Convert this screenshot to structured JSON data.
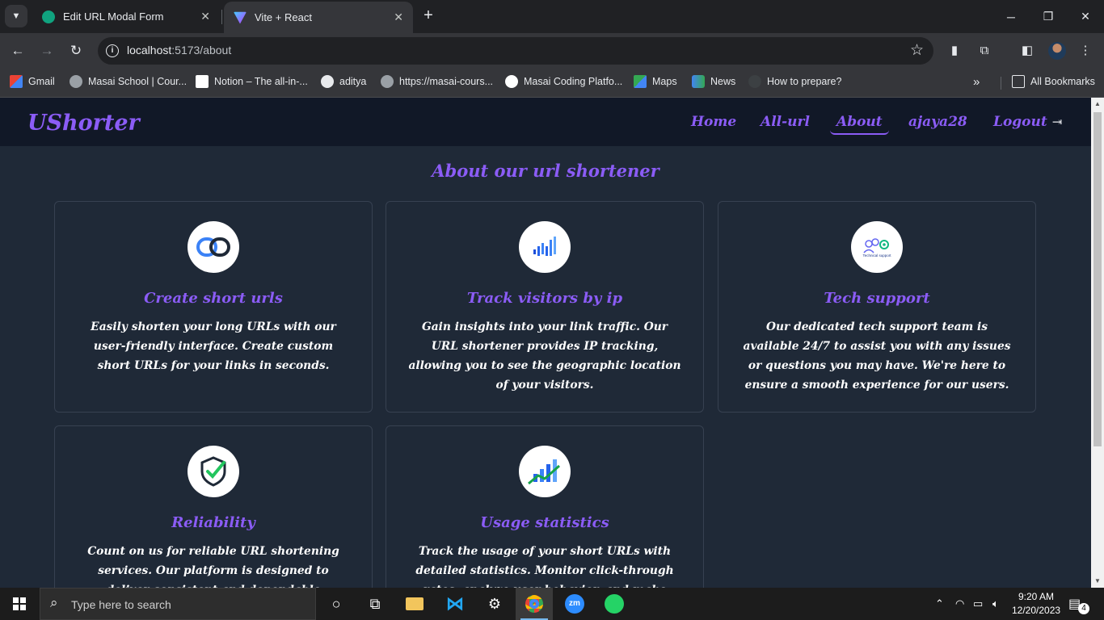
{
  "browser": {
    "tabs": [
      {
        "title": "Edit URL Modal Form",
        "active": false
      },
      {
        "title": "Vite + React",
        "active": true
      }
    ],
    "url_host": "localhost",
    "url_path": ":5173/about",
    "bookmarks": [
      {
        "label": "Gmail",
        "icon": "gmail-icon"
      },
      {
        "label": "Masai School | Cour...",
        "icon": "globe-icon"
      },
      {
        "label": "Notion – The all-in-...",
        "icon": "notion-icon"
      },
      {
        "label": "aditya",
        "icon": "github-icon"
      },
      {
        "label": "https://masai-cours...",
        "icon": "globe-icon"
      },
      {
        "label": "Masai Coding Platfo...",
        "icon": "masai-icon"
      },
      {
        "label": "Maps",
        "icon": "maps-icon"
      },
      {
        "label": "News",
        "icon": "news-icon"
      },
      {
        "label": "How to prepare?",
        "icon": "page-icon"
      }
    ],
    "all_bookmarks": "All Bookmarks"
  },
  "app": {
    "brand": "UShorter",
    "nav": [
      {
        "label": "Home",
        "active": false
      },
      {
        "label": "All-url",
        "active": false
      },
      {
        "label": "About",
        "active": true
      },
      {
        "label": "ajaya28",
        "active": false
      },
      {
        "label": "Logout",
        "active": false
      }
    ],
    "heading": "About our url shortener",
    "cards": [
      {
        "title": "Create short urls",
        "icon": "chain-link-icon",
        "desc": "Easily shorten your long URLs with our user-friendly interface. Create custom short URLs for your links in seconds."
      },
      {
        "title": "Track visitors by ip",
        "icon": "bar-signal-icon",
        "desc": "Gain insights into your link traffic. Our URL shortener provides IP tracking, allowing you to see the geographic location of your visitors."
      },
      {
        "title": "Tech support",
        "icon": "tech-support-icon",
        "icon_text": "Technical support",
        "desc": "Our dedicated tech support team is available 24/7 to assist you with any issues or questions you may have. We're here to ensure a smooth experience for our users."
      },
      {
        "title": "Reliability",
        "icon": "shield-check-icon",
        "desc": "Count on us for reliable URL shortening services. Our platform is designed to deliver consistent and dependable performance."
      },
      {
        "title": "Usage statistics",
        "icon": "growth-chart-icon",
        "desc": "Track the usage of your short URLs with detailed statistics. Monitor click-through rates, analyze user behavior, and make"
      }
    ],
    "colors": {
      "accent": "#8b5cf6",
      "navbar_bg": "#111827",
      "page_bg": "#1f2937",
      "card_border": "#374151"
    }
  },
  "taskbar": {
    "search_placeholder": "Type here to search",
    "time": "9:20 AM",
    "date": "12/20/2023",
    "notification_count": "4"
  }
}
